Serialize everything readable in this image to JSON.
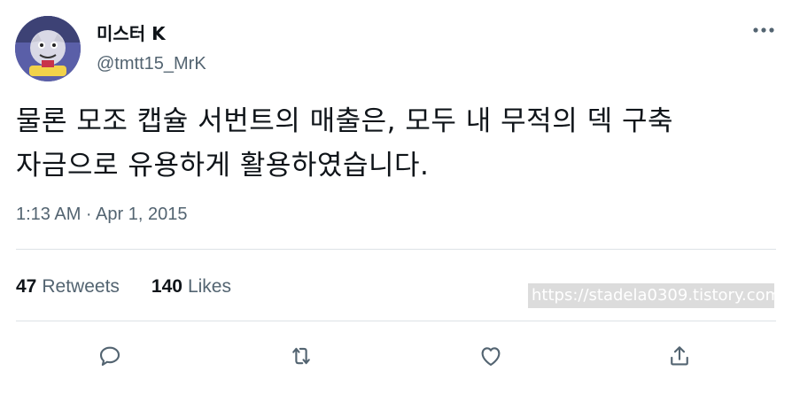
{
  "user": {
    "display_name": "미스터 K",
    "handle": "@tmtt15_MrK",
    "avatar_icon": "avatar-image"
  },
  "tweet": {
    "line1": "물론 모조 캡슐 서번트의 매출은, 모두 내 무적의 덱 구축",
    "line2": "자금으로 유용하게 활용하였습니다.",
    "timestamp": "1:13 AM · Apr 1, 2015"
  },
  "stats": {
    "retweets_count": "47",
    "retweets_label": "Retweets",
    "likes_count": "140",
    "likes_label": "Likes"
  },
  "watermark": "https://stadela0309.tistory.com",
  "actions": [
    "reply-icon",
    "retweet-icon",
    "like-icon",
    "share-icon"
  ],
  "colors": {
    "text_primary": "#0f1419",
    "text_secondary": "#536471",
    "divider": "#dde2e6",
    "watermark_bg": "#dcdcdc"
  }
}
